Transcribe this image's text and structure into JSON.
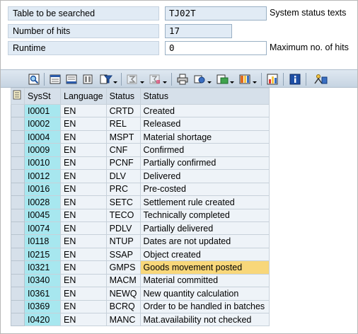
{
  "header": {
    "rows": [
      {
        "label": "Table to be searched",
        "value": "TJ02T",
        "description": "System status texts"
      },
      {
        "label": "Number of hits",
        "value": "17",
        "description": ""
      },
      {
        "label": "Runtime",
        "value": "0",
        "description": "Maximum no. of hits"
      }
    ]
  },
  "toolbar": {
    "buttons": [
      {
        "icon": "details-icon"
      },
      {
        "icon": "sort-ascending-icon"
      },
      {
        "icon": "sort-descending-icon"
      },
      {
        "icon": "find-icon"
      },
      {
        "icon": "filter-icon"
      },
      {
        "icon": "total-icon"
      },
      {
        "icon": "subtotal-icon"
      },
      {
        "icon": "print-icon"
      },
      {
        "icon": "views-icon"
      },
      {
        "icon": "export-icon"
      },
      {
        "icon": "layout-icon"
      },
      {
        "icon": "graphic-icon"
      },
      {
        "icon": "info-icon"
      },
      {
        "icon": "abc-analysis-icon"
      }
    ]
  },
  "table": {
    "columns": [
      "SysSt",
      "Language",
      "Status",
      "Status"
    ],
    "rows": [
      [
        "I0001",
        "EN",
        "CRTD",
        "Created"
      ],
      [
        "I0002",
        "EN",
        "REL",
        "Released"
      ],
      [
        "I0004",
        "EN",
        "MSPT",
        "Material shortage"
      ],
      [
        "I0009",
        "EN",
        "CNF",
        "Confirmed"
      ],
      [
        "I0010",
        "EN",
        "PCNF",
        "Partially confirmed"
      ],
      [
        "I0012",
        "EN",
        "DLV",
        "Delivered"
      ],
      [
        "I0016",
        "EN",
        "PRC",
        "Pre-costed"
      ],
      [
        "I0028",
        "EN",
        "SETC",
        "Settlement rule created"
      ],
      [
        "I0045",
        "EN",
        "TECO",
        "Technically completed"
      ],
      [
        "I0074",
        "EN",
        "PDLV",
        "Partially delivered"
      ],
      [
        "I0118",
        "EN",
        "NTUP",
        "Dates are not updated"
      ],
      [
        "I0215",
        "EN",
        "SSAP",
        "Object created"
      ],
      [
        "I0321",
        "EN",
        "GMPS",
        "Goods movement posted"
      ],
      [
        "I0340",
        "EN",
        "MACM",
        "Material committed"
      ],
      [
        "I0361",
        "EN",
        "NEWQ",
        "New quantity calculation"
      ],
      [
        "I0369",
        "EN",
        "BCRQ",
        "Order to be handled in batches"
      ],
      [
        "I0420",
        "EN",
        "MANC",
        "Mat.availability not checked"
      ]
    ],
    "highlighted_row": 12
  },
  "colors": {
    "key_column": "#a7e7ef",
    "data_cell": "#eef3f8",
    "header": "#d6e0ea",
    "highlight": "#f8d77a"
  }
}
